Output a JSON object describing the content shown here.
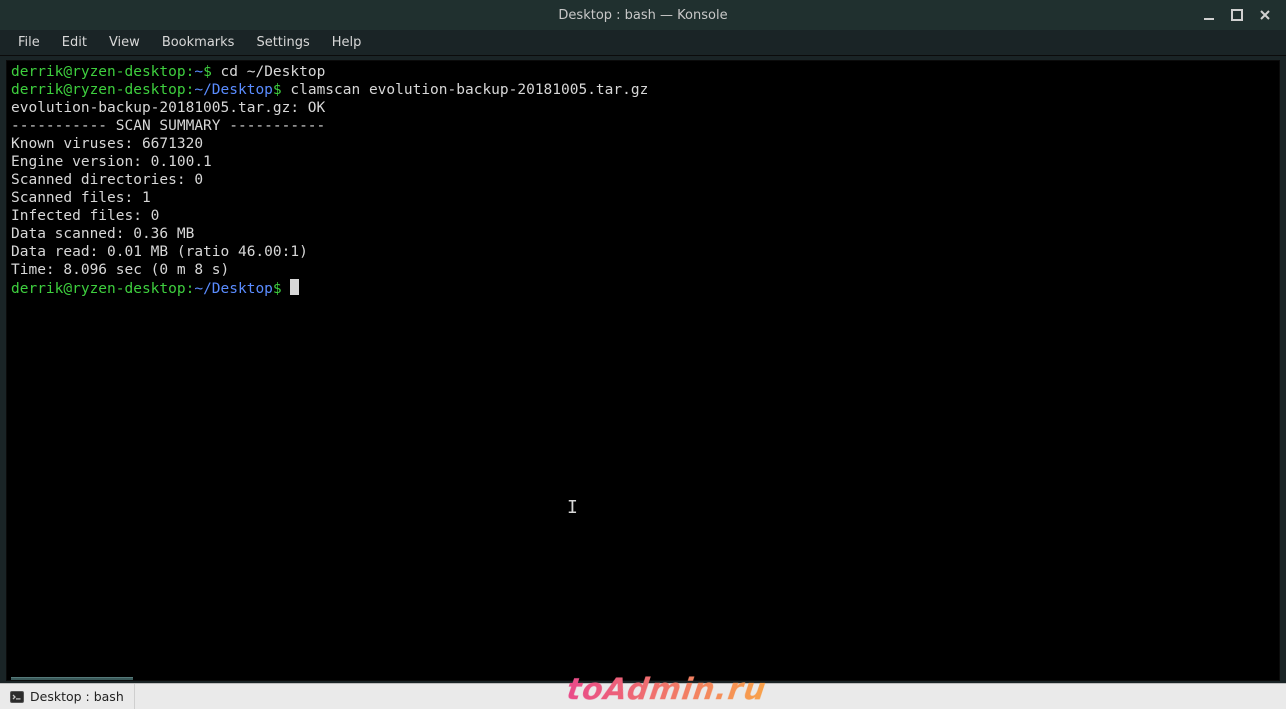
{
  "titlebar": {
    "title": "Desktop : bash — Konsole"
  },
  "menubar": {
    "items": [
      "File",
      "Edit",
      "View",
      "Bookmarks",
      "Settings",
      "Help"
    ]
  },
  "terminal": {
    "prompt": {
      "user_host": "derrik@ryzen-desktop",
      "colon": ":",
      "home_path": "~",
      "desktop_path": "~/Desktop",
      "dollar": "$"
    },
    "lines": {
      "l1_cmd": " cd ~/Desktop",
      "l2_cmd": " clamscan evolution-backup-20181005.tar.gz",
      "l3": "evolution-backup-20181005.tar.gz: OK",
      "l4": "",
      "l5": "----------- SCAN SUMMARY -----------",
      "l6": "Known viruses: 6671320",
      "l7": "Engine version: 0.100.1",
      "l8": "Scanned directories: 0",
      "l9": "Scanned files: 1",
      "l10": "Infected files: 0",
      "l11": "Data scanned: 0.36 MB",
      "l12": "Data read: 0.01 MB (ratio 46.00:1)",
      "l13": "Time: 8.096 sec (0 m 8 s)"
    }
  },
  "tabbar": {
    "tab1": "Desktop : bash"
  },
  "watermark": "toAdmin.ru"
}
